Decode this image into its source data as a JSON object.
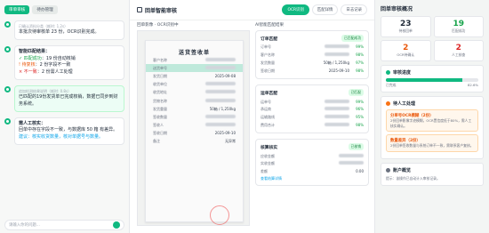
{
  "chat": {
    "tabs": [
      "审单审核",
      "待办管理"
    ],
    "messages": [
      {
        "meta": "已确认资料分类（耗时: 1.2s）",
        "text": "本批次待审核单 23 份，OCR识别完成。"
      },
      {
        "title": "智能匹配结果：",
        "lines": [
          {
            "mark": "✓",
            "label": "匹配成功",
            "rest": "：19 份自动核销"
          },
          {
            "mark": "!",
            "label": "待复核",
            "rest": "：2 份字段不一致"
          },
          {
            "mark": "×",
            "label": "不一致",
            "rest": "：2 份需人工处理"
          }
        ]
      },
      {
        "meta": "追加检测结果说明（耗时: 0.8s）",
        "text": "已匹配的19份发货单已完成核销，数据已同步到财务系统。"
      },
      {
        "title": "需人工核实：",
        "text": "回单中存在字段不一致，与数据库 50 箱 有差异。",
        "link": "建议：核实收货数量，核对单据号与数量。"
      }
    ],
    "input_placeholder": "请输入你的问题..."
  },
  "main": {
    "title": "回单智能审核",
    "tabs": [
      "OCR识别",
      "匹配详情",
      "日志记录"
    ],
    "doc_panel_title": "回单影像 · OCR识别中",
    "doc": {
      "title": "送货签收单",
      "rows": [
        {
          "k": "客户名称",
          "v": ""
        },
        {
          "k": "送货单号",
          "v": ""
        },
        {
          "k": "发货日期",
          "v": "2025-09-08"
        },
        {
          "k": "收货单位",
          "v": ""
        },
        {
          "k": "收货地址",
          "v": ""
        },
        {
          "k": "货物名称",
          "v": ""
        },
        {
          "k": "发货重量",
          "v": "50箱 / 1,250kg"
        },
        {
          "k": "签收数量",
          "v": ""
        },
        {
          "k": "签收人",
          "v": ""
        },
        {
          "k": "签收日期",
          "v": "2025-09-10"
        },
        {
          "k": "备注",
          "v": "无异常"
        }
      ]
    },
    "match_panel_title": "AI智能匹配结果",
    "cards": [
      {
        "title": "订单匹配",
        "badge": "已匹配成功",
        "rows": [
          {
            "k": "订单号",
            "v": "",
            "p": "99%"
          },
          {
            "k": "客户名称",
            "v": "",
            "p": "98%"
          },
          {
            "k": "发货数量",
            "v": "50箱 / 1,250kg",
            "p": "97%"
          },
          {
            "k": "签收日期",
            "v": "2025-09-10",
            "p": "98%"
          }
        ]
      },
      {
        "title": "运单匹配",
        "badge": "已匹配",
        "rows": [
          {
            "k": "运单号",
            "v": "",
            "p": "99%"
          },
          {
            "k": "承运商",
            "v": "",
            "p": "96%"
          },
          {
            "k": "运输路线",
            "v": "",
            "p": "95%"
          },
          {
            "k": "费用合计",
            "v": "",
            "p": "98%"
          }
        ]
      },
      {
        "title": "核算核实",
        "badge": "已核销",
        "rows": [
          {
            "k": "应收金额",
            "v": ""
          },
          {
            "k": "实收金额",
            "v": ""
          },
          {
            "k": "差额",
            "v": "0.00"
          }
        ],
        "link": "查看结算详情"
      }
    ]
  },
  "side": {
    "title": "回单审核概况",
    "stats": [
      {
        "num": "23",
        "label": "待核回单",
        "color": "#1f2937"
      },
      {
        "num": "19",
        "label": "匹配成功",
        "color": "#16a34a"
      },
      {
        "num": "2",
        "label": "OCR待确认",
        "color": "#ea580c"
      },
      {
        "num": "2",
        "label": "人工核查",
        "color": "#dc2626"
      }
    ],
    "progress": {
      "title": "审核进度",
      "value": 0.826,
      "left": "已完成",
      "right": "82.6%"
    },
    "todo_title": "待人工处理",
    "todos": [
      {
        "title": "分单号OCR模糊（2份）",
        "desc": "2份回单影像字迹模糊，OCR置信度低于80%，需人工核实确认。"
      },
      {
        "title": "数量差异（2份）",
        "desc": "2份回单签收数量与系统订单不一致，需联系客户复核。"
      }
    ],
    "account_title": "账户概览",
    "account_note": "提示：该操作已自动计入审核记录。"
  }
}
